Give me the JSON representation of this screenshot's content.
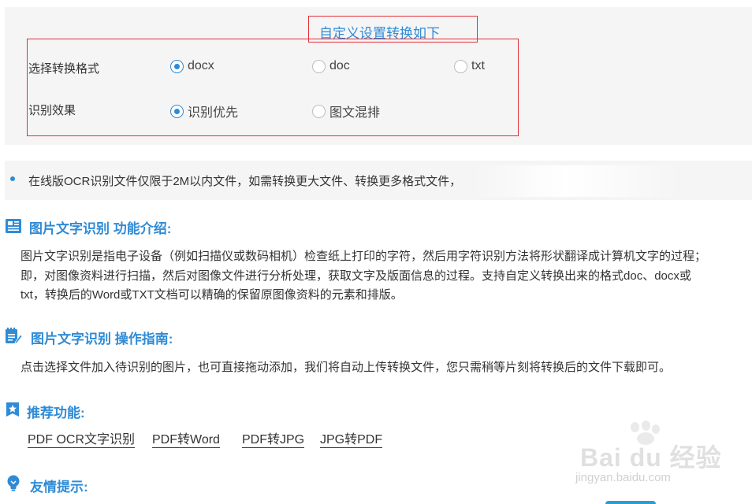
{
  "settings": {
    "title": "自定义设置转换如下",
    "format": {
      "label": "选择转换格式",
      "options": [
        "docx",
        "doc",
        "txt"
      ],
      "selected": "docx"
    },
    "effect": {
      "label": "识别效果",
      "options": [
        "识别优先",
        "图文混排"
      ],
      "selected": "识别优先"
    }
  },
  "notice": "在线版OCR识别文件仅限于2M以内文件，如需转换更大文件、转换更多格式文件，",
  "intro": {
    "title": "图片文字识别 功能介绍:",
    "lines": [
      "图片文字识别是指电子设备（例如扫描仪或数码相机）检查纸上打印的字符，然后用字符识别方法将形状翻译成计算机文字的过程；",
      "即，对图像资料进行扫描，然后对图像文件进行分析处理，获取文字及版面信息的过程。支持自定义转换出来的格式doc、docx或",
      "txt，转换后的Word或TXT文档可以精确的保留原图像资料的元素和排版。"
    ]
  },
  "guide": {
    "title": "图片文字识别 操作指南:",
    "text": "点击选择文件加入待识别的图片，也可直接拖动添加，我们将自动上传转换文件，您只需稍等片刻将转换后的文件下载即可。"
  },
  "recommend": {
    "title": "推荐功能:",
    "links": [
      "PDF OCR文字识别",
      "PDF转Word",
      "PDF转JPG",
      "JPG转PDF"
    ]
  },
  "tips": {
    "title": "友情提示:"
  },
  "watermark": {
    "big": "Bai du 经验",
    "small": "jingyan.baidu.com"
  },
  "colors": {
    "accent": "#2f8bd6",
    "highlight_border": "#e2303a",
    "panel_bg": "#f5f5f5",
    "text": "#333333"
  }
}
